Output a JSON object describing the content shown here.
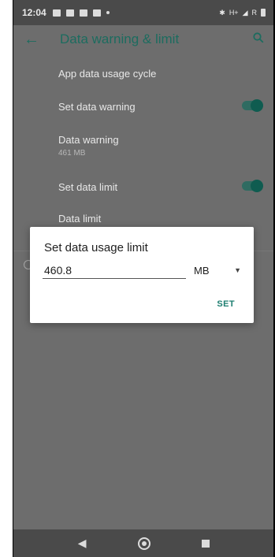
{
  "status_bar": {
    "time": "12:04",
    "network_label": "H+",
    "carrier_label": "R"
  },
  "toolbar": {
    "title": "Data warning & limit"
  },
  "settings": {
    "app_data_cycle": "App data usage cycle",
    "set_data_warning": "Set data warning",
    "data_warning": "Data warning",
    "data_warning_value": "461 MB",
    "set_data_limit": "Set data limit",
    "data_limit": "Data limit"
  },
  "dialog": {
    "title": "Set data usage limit",
    "input_value": "460.8",
    "unit": "MB",
    "set_label": "SET"
  },
  "colors": {
    "accent": "#1c6c5f",
    "scrim": "#6d6d6d",
    "dialog": "#ffffff"
  }
}
